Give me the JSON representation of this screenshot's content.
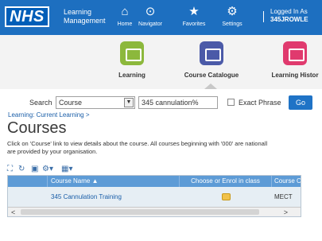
{
  "header": {
    "logo_text": "NHS",
    "app_title_line1": "Learning",
    "app_title_line2": "Management",
    "nav": [
      {
        "label": "Home",
        "icon": "home-icon",
        "glyph": "⌂"
      },
      {
        "label": "Navigator",
        "icon": "navigator-icon",
        "glyph": "⊙"
      },
      {
        "label": "Favorites",
        "icon": "star-icon",
        "glyph": "★"
      },
      {
        "label": "Settings",
        "icon": "gear-icon",
        "glyph": "⚙"
      }
    ],
    "logged_in_label": "Logged In As",
    "logged_in_user": "345JROWLE"
  },
  "springboard": {
    "items": [
      {
        "label": "Learning",
        "color": "#8cb83c"
      },
      {
        "label": "Course Catalogue",
        "color": "#4b5aa8"
      },
      {
        "label": "Learning Histor",
        "color": "#e03a6e"
      }
    ]
  },
  "search": {
    "label": "Search",
    "selected_option": "Course",
    "query_value": "345 cannulation%",
    "exact_phrase_label": "Exact Phrase",
    "exact_phrase_checked": false,
    "go_label": "Go"
  },
  "breadcrumb": "Learning: Current Learning >",
  "page_title": "Courses",
  "description_line1": "Click on 'Course' link to view details about the course. All courses beginning with '000' are nationall",
  "description_line2": "are provided by your organisation.",
  "table": {
    "toolbar_icons": [
      "fullscreen-icon",
      "refresh-icon",
      "export-icon",
      "settings-icon",
      "columns-icon"
    ],
    "columns": [
      "",
      "Course Name ▲",
      "Choose or Enrol in class",
      "Course Cc"
    ],
    "rows": [
      {
        "course_name": "345 Cannulation Training",
        "enrol_icon": "enrol-icon",
        "course_code": "MECT"
      }
    ]
  },
  "colors": {
    "header_blue": "#1d6fc0",
    "table_header": "#5d9bd6",
    "link": "#1a5ea8",
    "go_button": "#1f73c6"
  }
}
